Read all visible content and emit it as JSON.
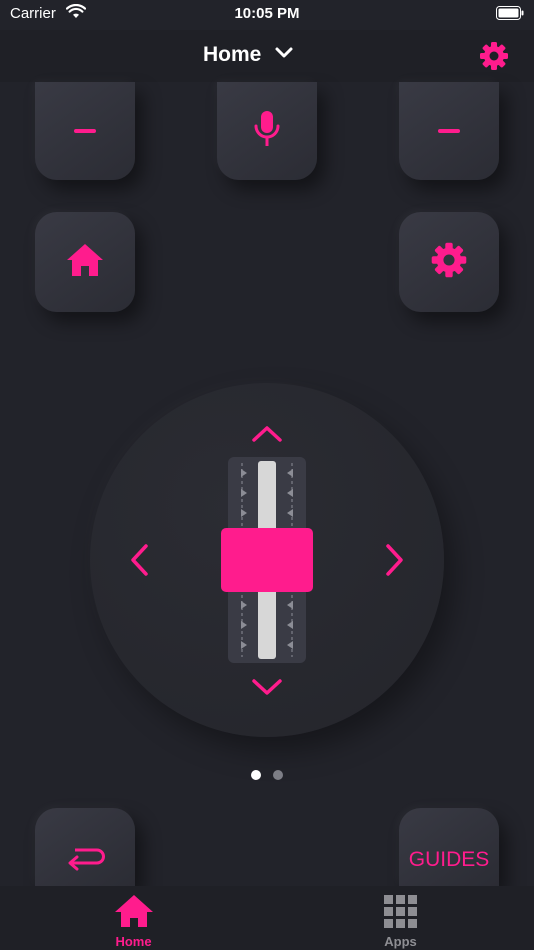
{
  "status_bar": {
    "carrier": "Carrier",
    "time": "10:05 PM"
  },
  "nav": {
    "title": "Home"
  },
  "remote": {
    "guides_label": "GUIDES",
    "page_indicator": {
      "pages": 2,
      "active": 1
    }
  },
  "tabs": [
    {
      "label": "Home",
      "icon": "home-icon",
      "active": true
    },
    {
      "label": "Apps",
      "icon": "grid-icon",
      "active": false
    }
  ],
  "colors": {
    "accent": "#ff1c8d",
    "background": "#22232a",
    "tile": "#33343d",
    "inactive": "#8e8e93"
  }
}
